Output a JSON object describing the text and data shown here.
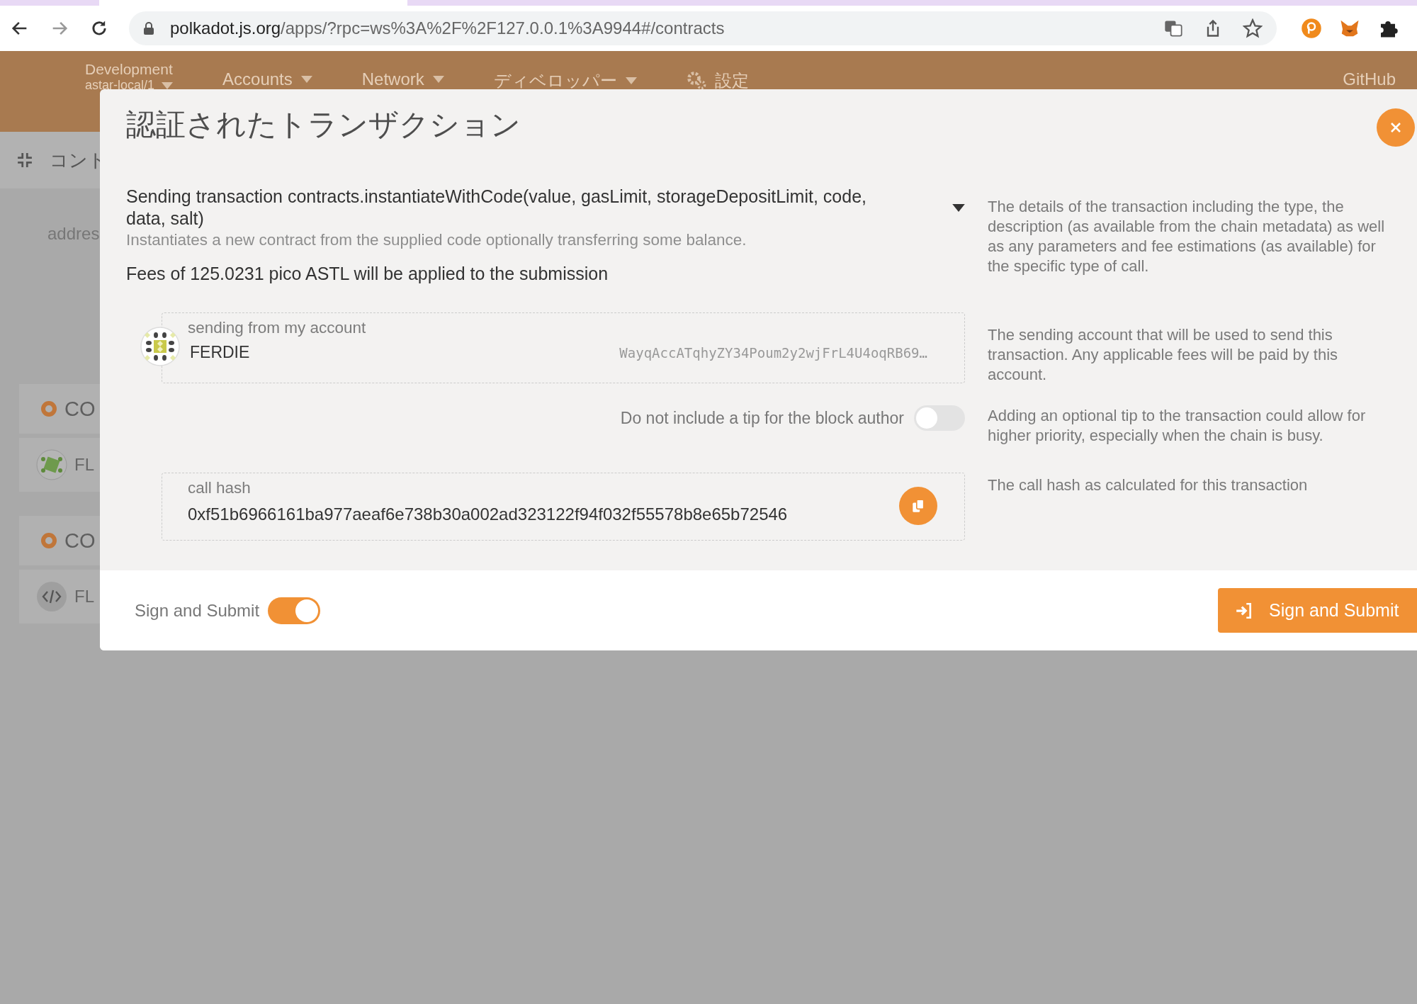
{
  "browser": {
    "url_host": "polkadot.js.org",
    "url_path": "/apps/?rpc=ws%3A%2F%2F127.0.0.1%3A9944#/contracts"
  },
  "nav": {
    "chain": "Development",
    "node": "astar-local/1",
    "items": [
      {
        "label": "Accounts",
        "kind": "menu"
      },
      {
        "label": "Network",
        "kind": "menu"
      },
      {
        "label": "ディベロッパー",
        "kind": "menu"
      },
      {
        "label": "設定",
        "kind": "settings"
      }
    ],
    "github": "GitHub"
  },
  "background": {
    "subnav": "コント",
    "address_label": "addres",
    "groups": [
      {
        "title": "CO",
        "item": {
          "kind": "identicon",
          "label": "FL"
        }
      },
      {
        "title": "CO",
        "item": {
          "kind": "code",
          "label": "FL"
        }
      }
    ]
  },
  "modal": {
    "title": "認証されたトランザクション",
    "call": {
      "text": "Sending transaction contracts.instantiateWithCode(value, gasLimit, storageDepositLimit, code, data, salt)",
      "description": "Instantiates a new contract from the supplied code optionally transferring some balance.",
      "fees": "Fees of 125.0231 pico ASTL will be applied to the submission",
      "help": "The details of the transaction including the type, the description (as available from the chain metadata) as well as any parameters and fee estimations (as available) for the specific type of call."
    },
    "account": {
      "label": "sending from my account",
      "name": "FERDIE",
      "address": "WayqAccATqhyZY34Poum2y2wjFrL4U4oqRB69…",
      "help": "The sending account that will be used to send this transaction. Any applicable fees will be paid by this account."
    },
    "tip": {
      "label": "Do not include a tip for the block author",
      "on": false,
      "help": "Adding an optional tip to the transaction could allow for higher priority, especially when the chain is busy."
    },
    "call_hash": {
      "label": "call hash",
      "value": "0xf51b6966161ba977aeaf6e738b30a002ad323122f94f032f55578b8e65b72546",
      "help": "The call hash as calculated for this transaction"
    },
    "footer": {
      "toggle_label": "Sign and Submit",
      "toggle_on": true,
      "button": "Sign and Submit"
    }
  }
}
